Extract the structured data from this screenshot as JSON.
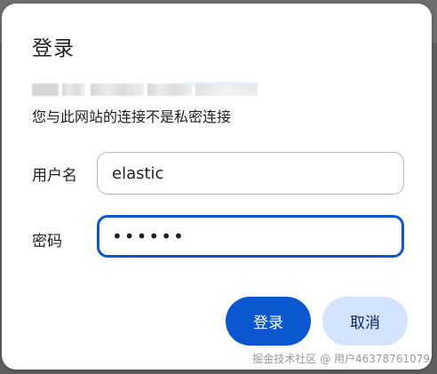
{
  "dialog": {
    "title": "登录",
    "site_url": "",
    "warning": "您与此网站的连接不是私密连接",
    "username_label": "用户名",
    "username_value": "elastic",
    "password_label": "密码",
    "password_value": "••••••",
    "login_label": "登录",
    "cancel_label": "取消"
  },
  "watermark": "掘金技术社区 @ 用户46378761079",
  "colors": {
    "primary": "#0b57d0",
    "secondary_button": "#d3e3fd",
    "backdrop": "#6e6e6e"
  }
}
